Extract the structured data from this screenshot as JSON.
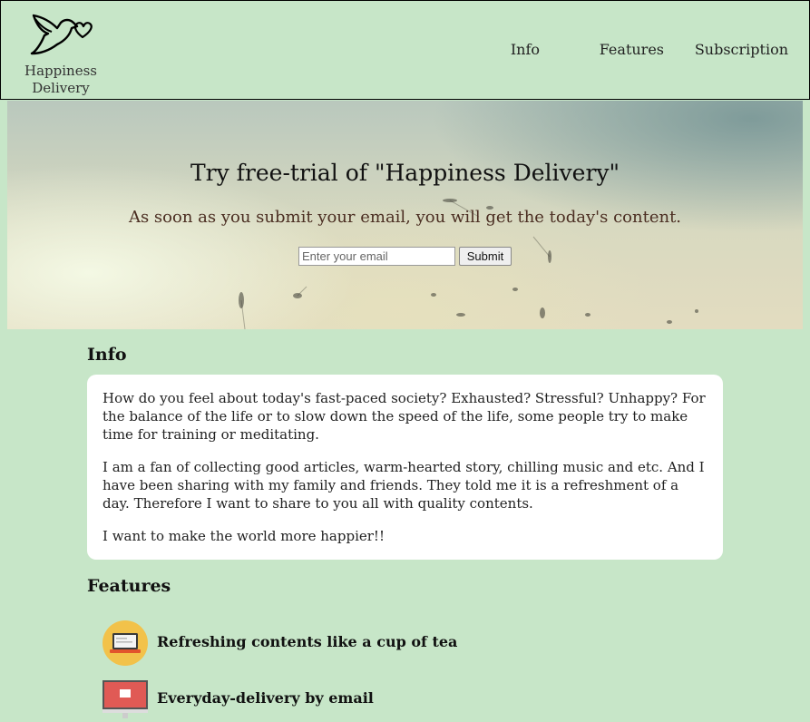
{
  "brand": {
    "name_line1": "Happiness",
    "name_line2": "Delivery"
  },
  "nav": [
    {
      "label": "Info"
    },
    {
      "label": "Features"
    },
    {
      "label": "Subscription"
    }
  ],
  "hero": {
    "title": "Try free-trial of \"Happiness Delivery\"",
    "subtitle": "As soon as you submit your email, you will get the today's content.",
    "email_placeholder": "Enter your email",
    "submit_label": "Submit"
  },
  "info": {
    "heading": "Info",
    "paragraphs": [
      "How do you feel about today's fast-paced society? Exhausted? Stressful? Unhappy? For the balance of the life or to slow down the speed of the life, some people try to make time for training or meditating.",
      "I am a fan of collecting good articles, warm-hearted story, chilling music and etc. And I have been sharing with my family and friends. They told me it is a refreshment of a day. Therefore I want to share to you all with quality contents.",
      "I want to make the world more happier!!"
    ]
  },
  "features": {
    "heading": "Features",
    "items": [
      {
        "label": "Refreshing contents like a cup of tea",
        "icon": "laptop-icon"
      },
      {
        "label": "Everyday-delivery by email",
        "icon": "monitor-icon"
      }
    ]
  },
  "colors": {
    "page_bg": "#c7e6c8",
    "subtitle": "#4b2e22",
    "card_bg": "#ffffff",
    "laptop_circle": "#f2c24a",
    "monitor_screen": "#e05a55"
  }
}
